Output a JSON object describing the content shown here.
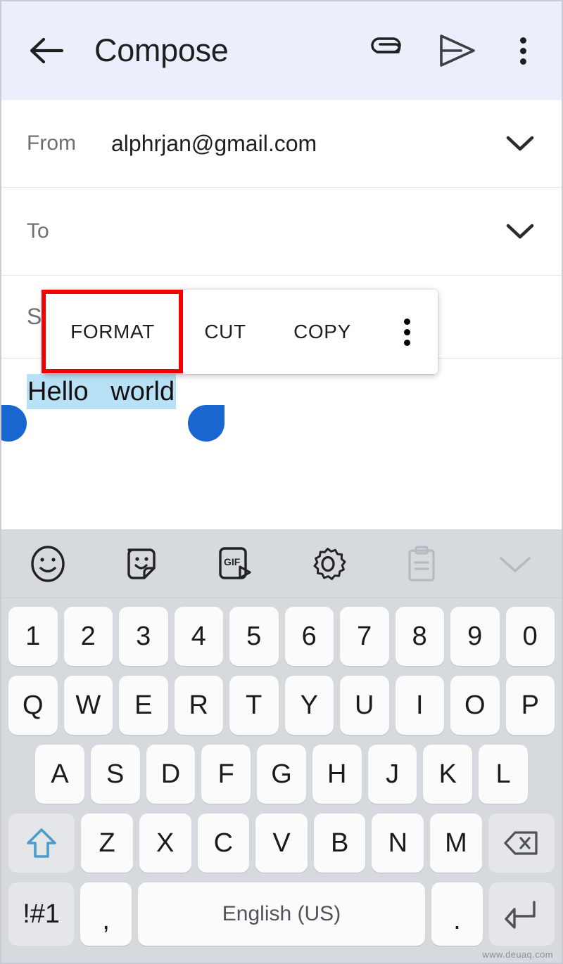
{
  "app": {
    "screen_name": "Gmail Compose"
  },
  "appbar": {
    "back_icon": "arrow-left-icon",
    "title": "Compose",
    "attach_icon": "paperclip-icon",
    "send_icon": "send-icon",
    "overflow_icon": "more-vert-icon",
    "background": "#eaeffb"
  },
  "compose": {
    "from": {
      "label": "From",
      "value": "alphrjan@gmail.com",
      "chevron_icon": "chevron-down-icon"
    },
    "to": {
      "label": "To",
      "value": "",
      "chevron_icon": "chevron-down-icon"
    },
    "subject": {
      "label": "Subject",
      "value": ""
    },
    "body": {
      "text": "Hello   world",
      "selected": true,
      "selection_color": "#b9e1f5",
      "handle_color": "#1a66d0"
    }
  },
  "context_menu": {
    "items": [
      {
        "label": "FORMAT",
        "highlighted": true
      },
      {
        "label": "CUT",
        "highlighted": false
      },
      {
        "label": "COPY",
        "highlighted": false
      }
    ],
    "overflow_icon": "more-vert-icon"
  },
  "annotation": {
    "color": "#f40000",
    "target": "FORMAT"
  },
  "keyboard": {
    "toolbar": [
      {
        "name": "emoji-icon",
        "enabled": true
      },
      {
        "name": "sticker-icon",
        "enabled": true
      },
      {
        "name": "gif-icon",
        "label": "GIF",
        "enabled": true
      },
      {
        "name": "settings-gear-icon",
        "enabled": true
      },
      {
        "name": "clipboard-icon",
        "enabled": false
      },
      {
        "name": "chevron-down-icon",
        "enabled": false
      }
    ],
    "row_numbers": [
      "1",
      "2",
      "3",
      "4",
      "5",
      "6",
      "7",
      "8",
      "9",
      "0"
    ],
    "row_top": [
      "Q",
      "W",
      "E",
      "R",
      "T",
      "Y",
      "U",
      "I",
      "O",
      "P"
    ],
    "row_home": [
      "A",
      "S",
      "D",
      "F",
      "G",
      "H",
      "J",
      "K",
      "L"
    ],
    "row_bottom_letters": [
      "Z",
      "X",
      "C",
      "V",
      "B",
      "N",
      "M"
    ],
    "shift_icon": "shift-arrow-up-icon",
    "backspace_icon": "backspace-icon",
    "symbols_key": "!#1",
    "comma_key": ",",
    "space_key": "English (US)",
    "period_key": ".",
    "enter_icon": "enter-return-icon",
    "background": "#d6d9de",
    "key_background": "#fbfbfc",
    "fn_key_background": "#e4e6ea",
    "shift_color": "#4a9cc9"
  },
  "watermark": {
    "text": "www.deuaq.com"
  }
}
